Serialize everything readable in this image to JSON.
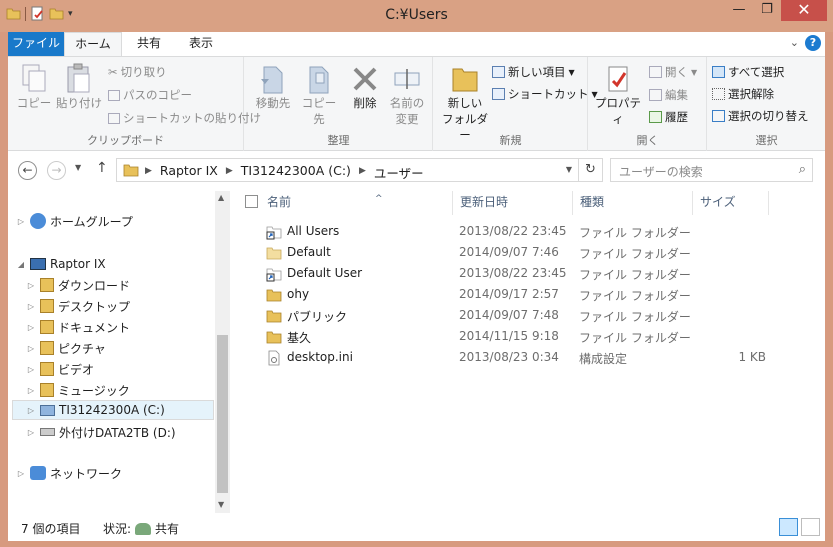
{
  "window": {
    "title": "C:¥Users"
  },
  "tabs": {
    "file": "ファイル",
    "home": "ホーム",
    "share": "共有",
    "view": "表示"
  },
  "ribbon": {
    "clipboard": {
      "label": "クリップボード",
      "copy": "コピー",
      "paste": "貼り付け",
      "cut": "切り取り",
      "copy_path": "パスのコピー",
      "paste_shortcut": "ショートカットの貼り付け"
    },
    "organize": {
      "label": "整理",
      "move_to": "移動先",
      "copy_to": "コピー先",
      "delete": "削除",
      "rename_1": "名前の",
      "rename_2": "変更"
    },
    "new": {
      "label": "新規",
      "new_folder_1": "新しい",
      "new_folder_2": "フォルダー",
      "new_item": "新しい項目",
      "easy_access": "ショートカット"
    },
    "open": {
      "label": "開く",
      "properties": "プロパティ",
      "open": "開く",
      "edit": "編集",
      "history": "履歴"
    },
    "select": {
      "label": "選択",
      "select_all": "すべて選択",
      "select_none": "選択解除",
      "invert": "選択の切り替え"
    }
  },
  "address": {
    "crumbs": [
      "Raptor IX",
      "TI31242300A (C:)",
      "ユーザー"
    ],
    "search_placeholder": "ユーザーの検索"
  },
  "nav": {
    "homegroup": "ホームグループ",
    "computer": "Raptor IX",
    "items": [
      "ダウンロード",
      "デスクトップ",
      "ドキュメント",
      "ピクチャ",
      "ビデオ",
      "ミュージック",
      "TI31242300A (C:)",
      "外付けDATA2TB (D:)"
    ],
    "network": "ネットワーク"
  },
  "columns": {
    "name": "名前",
    "date": "更新日時",
    "type": "種類",
    "size": "サイズ"
  },
  "files": [
    {
      "name": "All Users",
      "date": "2013/08/22 23:45",
      "type": "ファイル フォルダー",
      "size": "",
      "icon": "shortcut-folder"
    },
    {
      "name": "Default",
      "date": "2014/09/07 7:46",
      "type": "ファイル フォルダー",
      "size": "",
      "icon": "folder-light"
    },
    {
      "name": "Default User",
      "date": "2013/08/22 23:45",
      "type": "ファイル フォルダー",
      "size": "",
      "icon": "shortcut-folder"
    },
    {
      "name": "ohy",
      "date": "2014/09/17 2:57",
      "type": "ファイル フォルダー",
      "size": "",
      "icon": "folder"
    },
    {
      "name": "パブリック",
      "date": "2014/09/07 7:48",
      "type": "ファイル フォルダー",
      "size": "",
      "icon": "folder"
    },
    {
      "name": "基久",
      "date": "2014/11/15 9:18",
      "type": "ファイル フォルダー",
      "size": "",
      "icon": "folder"
    },
    {
      "name": "desktop.ini",
      "date": "2013/08/23 0:34",
      "type": "構成設定",
      "size": "1 KB",
      "icon": "ini-file"
    }
  ],
  "status": {
    "count": "7 個の項目",
    "state_label": "状況:",
    "state_value": "共有"
  },
  "colors": {
    "title_bar": "#d9a184",
    "file_tab": "#1979ca",
    "selected_row": "#e5f3fb",
    "folder": "#e8c15a"
  }
}
